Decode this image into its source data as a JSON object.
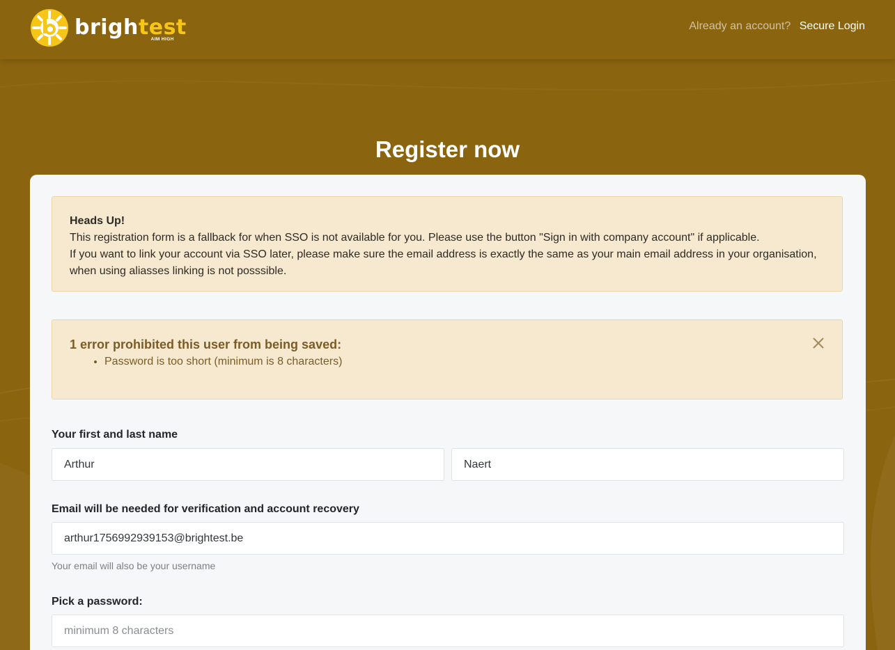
{
  "brand": {
    "name_part1": "brigh",
    "name_part2": "test",
    "tagline": "AIM HIGH",
    "primary_color": "#8a640f",
    "accent_color": "#f5c518"
  },
  "header": {
    "account_question": "Already an account?",
    "login_link": "Secure Login"
  },
  "page": {
    "title": "Register now"
  },
  "info_alert": {
    "title": "Heads Up!",
    "line1": "This registration form is a fallback for when SSO is not available for you. Please use the button \"Sign in with company account\" if applicable.",
    "line2": "If you want to link your account via SSO later, please make sure the email address is exactly the same as your main email address in your organisation, when using aliasses linking is not posssible."
  },
  "error_alert": {
    "title": "1 error prohibited this user from being saved:",
    "errors": [
      "Password is too short (minimum is 8 characters)"
    ],
    "close_icon": "close-icon"
  },
  "form": {
    "name_label": "Your first and last name",
    "first_name": "Arthur",
    "last_name": "Naert",
    "email_label": "Email will be needed for verification and account recovery",
    "email": "arthur1756992939153@brightest.be",
    "email_help": "Your email will also be your username",
    "password_label": "Pick a password:",
    "password_placeholder": "minimum 8 characters",
    "password_value": ""
  }
}
